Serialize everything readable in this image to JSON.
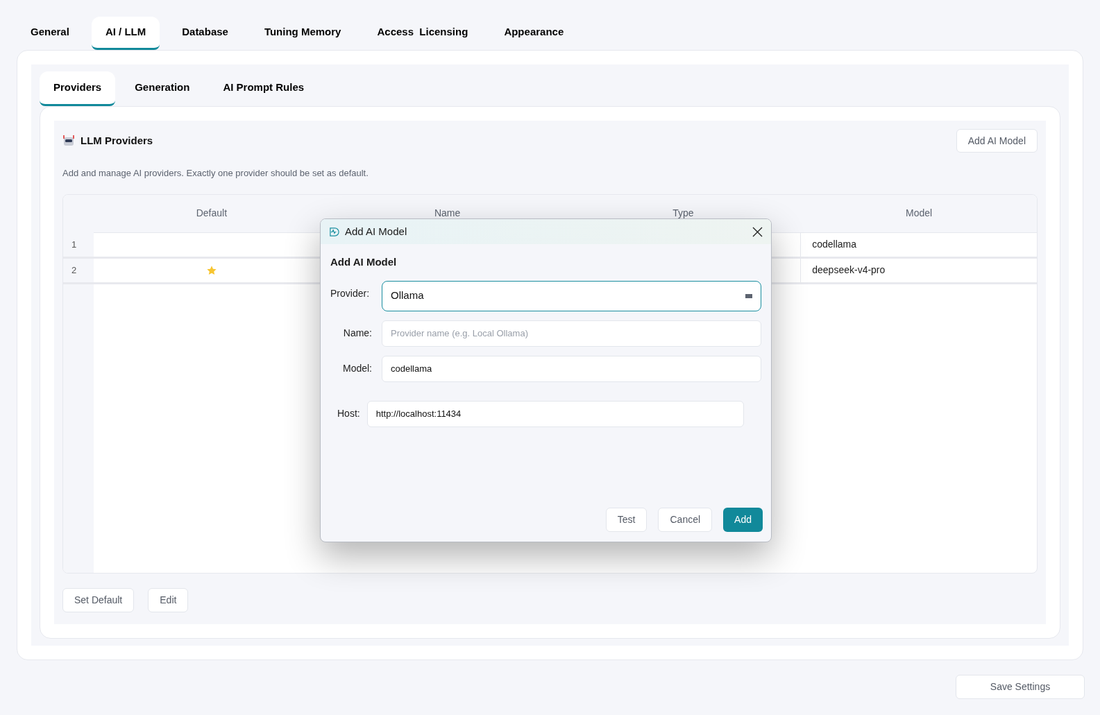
{
  "tabs": [
    {
      "label": "General",
      "selected": false
    },
    {
      "label": "AI / LLM",
      "selected": true
    },
    {
      "label": "Database",
      "selected": false
    },
    {
      "label": "Tuning Memory",
      "selected": false
    },
    {
      "label": "Access  Licensing",
      "selected": false
    },
    {
      "label": "Appearance",
      "selected": false
    }
  ],
  "subtabs": [
    {
      "label": "Providers",
      "selected": true
    },
    {
      "label": "Generation",
      "selected": false
    },
    {
      "label": "AI Prompt Rules",
      "selected": false
    }
  ],
  "section": {
    "title": "LLM Providers",
    "add_button": "Add AI Model",
    "description": "Add and manage AI providers. Exactly one provider should be set as default."
  },
  "table": {
    "columns": [
      "Default",
      "Name",
      "Type",
      "Model"
    ],
    "rows": [
      {
        "number": "1",
        "default": false,
        "model": "codellama"
      },
      {
        "number": "2",
        "default": true,
        "model": "deepseek-v4-pro"
      }
    ]
  },
  "actions": [
    "Set Default",
    "Edit"
  ],
  "save_button": "Save Settings",
  "dialog": {
    "title": "Add AI Model",
    "heading": "Add AI Model",
    "provider": {
      "label": "Provider:",
      "value": "Ollama"
    },
    "name": {
      "label": "Name:",
      "placeholder": "Provider name (e.g. Local Ollama)"
    },
    "model": {
      "label": "Model:",
      "value": "codellama"
    },
    "host": {
      "label": "Host:",
      "value": "http://localhost:11434"
    },
    "buttons": [
      {
        "label": "Test",
        "kind": "secondary"
      },
      {
        "label": "Cancel",
        "kind": "secondary"
      },
      {
        "label": "Add",
        "kind": "primary"
      }
    ]
  }
}
